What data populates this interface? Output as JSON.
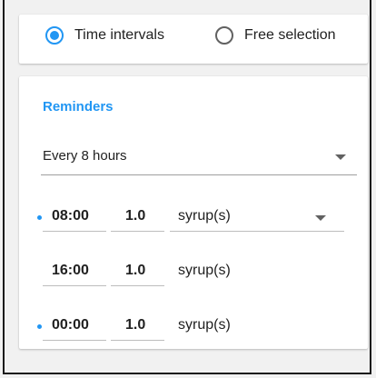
{
  "mode": {
    "options": [
      {
        "label": "Time intervals",
        "selected": true
      },
      {
        "label": "Free selection",
        "selected": false
      }
    ]
  },
  "reminders": {
    "title": "Reminders",
    "frequency": "Every 8 hours",
    "rows": [
      {
        "time": "08:00",
        "quantity": "1.0",
        "unit": "syrup(s)",
        "highlighted": true,
        "unit_dropdown": true
      },
      {
        "time": "16:00",
        "quantity": "1.0",
        "unit": "syrup(s)",
        "highlighted": false,
        "unit_dropdown": false
      },
      {
        "time": "00:00",
        "quantity": "1.0",
        "unit": "syrup(s)",
        "highlighted": true,
        "unit_dropdown": false
      }
    ]
  },
  "colors": {
    "accent": "#2196f3",
    "background": "#f1f1f1",
    "card": "#ffffff"
  }
}
